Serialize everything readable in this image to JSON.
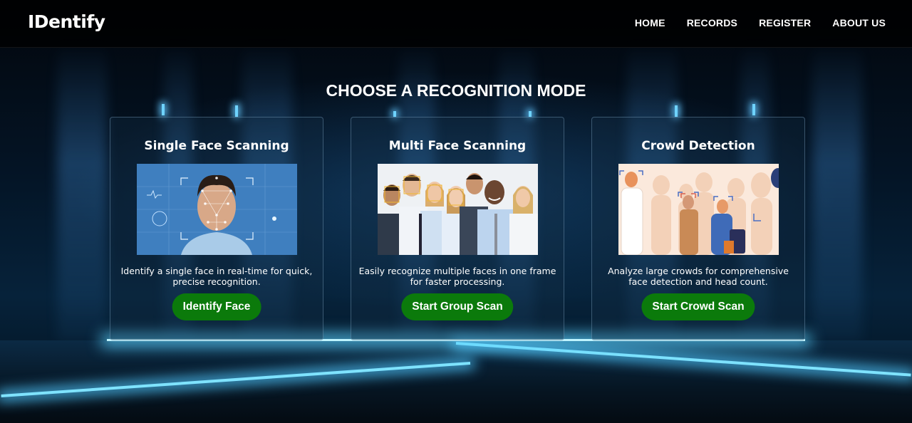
{
  "app": {
    "logo": "IDentify"
  },
  "nav": {
    "items": [
      "HOME",
      "RECORDS",
      "REGISTER",
      "ABOUT US"
    ]
  },
  "main": {
    "title": "CHOOSE A RECOGNITION MODE",
    "cards": [
      {
        "title": "Single Face Scanning",
        "description": "Identify a single face in real-time for quick, precise recognition.",
        "button": "Identify Face"
      },
      {
        "title": "Multi Face Scanning",
        "description": "Easily recognize multiple faces in one frame for faster processing.",
        "button": "Start Group Scan"
      },
      {
        "title": "Crowd Detection",
        "description": "Analyze large crowds for comprehensive face detection and head count.",
        "button": "Start Crowd Scan"
      }
    ]
  },
  "colors": {
    "button": "#0b7a0b",
    "header": "#000000",
    "accent_glow": "#7fe3ff"
  }
}
